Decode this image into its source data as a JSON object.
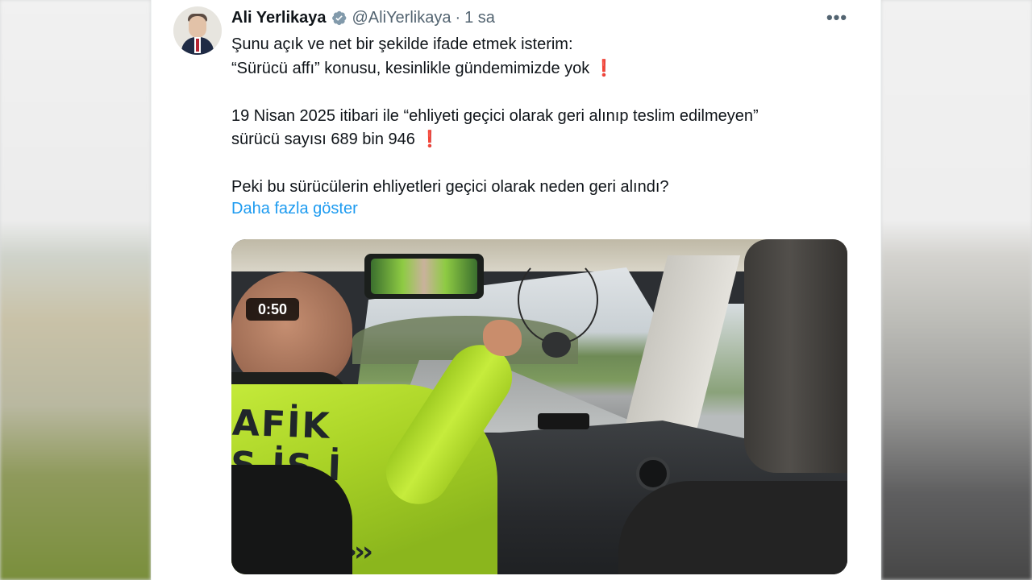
{
  "author": {
    "name": "Ali Yerlikaya",
    "handle": "@AliYerlikaya",
    "separator": "·",
    "time": "1 sa"
  },
  "menu": {
    "more_label": "•••"
  },
  "tweet": {
    "lines": [
      "Şunu açık ve net bir şekilde ifade etmek isterim:",
      "“Sürücü affı” konusu, kesinlikle gündemimizde yok",
      "19 Nisan 2025 itibari ile “ehliyeti geçici olarak geri alınıp teslim edilmeyen”",
      "sürücü sayısı 689 bin 946",
      "Peki bu sürücülerin ehliyetleri geçici olarak neden geri alındı?"
    ],
    "exclamation": "❗",
    "show_more": "Daha fazla göster"
  },
  "media": {
    "duration": "0:50",
    "jacket_text_1": "AFİK",
    "jacket_text_2": "Ş İS İ",
    "chevrons": "›››"
  },
  "colors": {
    "link": "#1d9bf0",
    "text": "#0f1419",
    "secondary": "#536471",
    "verified": "#829aab",
    "alert": "#e0242f"
  },
  "icons": {
    "verified": "verified-badge-icon",
    "more": "more-icon",
    "exclamation": "red-exclamation-icon"
  }
}
